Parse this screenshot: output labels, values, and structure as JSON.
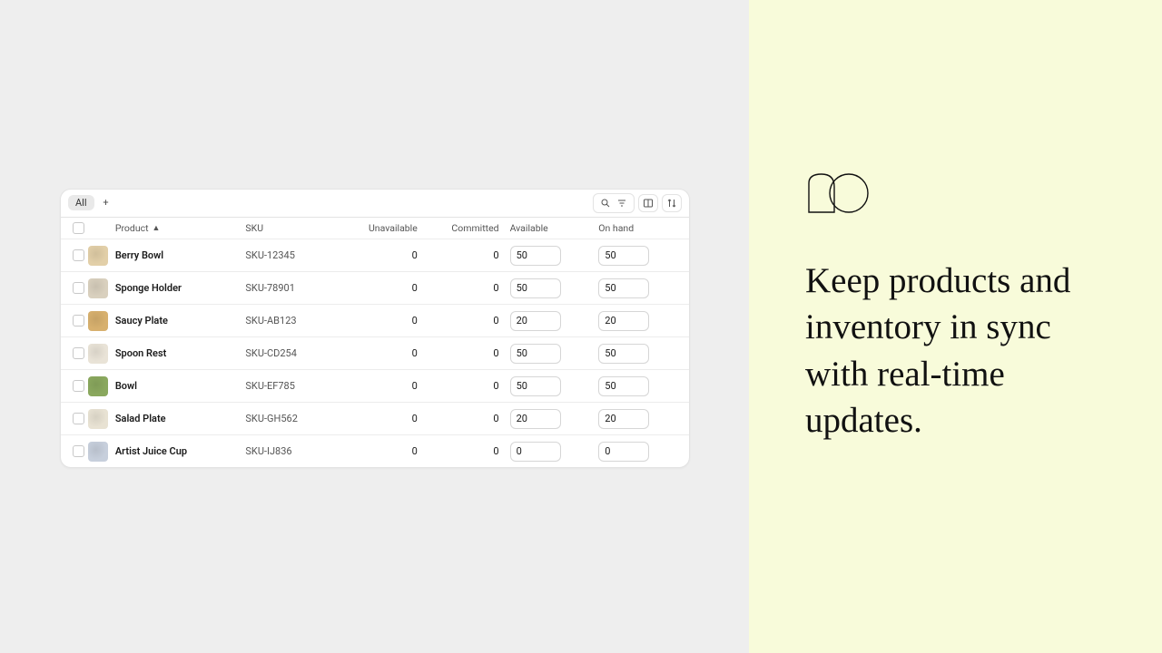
{
  "toolbar": {
    "tab_all": "All"
  },
  "columns": {
    "product": "Product",
    "sku": "SKU",
    "unavailable": "Unavailable",
    "committed": "Committed",
    "available": "Available",
    "on_hand": "On hand"
  },
  "rows": [
    {
      "name": "Berry Bowl",
      "sku": "SKU-12345",
      "unavailable": "0",
      "committed": "0",
      "available": "50",
      "on_hand": "50",
      "thumb": "#e2cfa8"
    },
    {
      "name": "Sponge Holder",
      "sku": "SKU-78901",
      "unavailable": "0",
      "committed": "0",
      "available": "50",
      "on_hand": "50",
      "thumb": "#d9d0be"
    },
    {
      "name": "Saucy Plate",
      "sku": "SKU-AB123",
      "unavailable": "0",
      "committed": "0",
      "available": "20",
      "on_hand": "20",
      "thumb": "#d7b06e"
    },
    {
      "name": "Spoon Rest",
      "sku": "SKU-CD254",
      "unavailable": "0",
      "committed": "0",
      "available": "50",
      "on_hand": "50",
      "thumb": "#e9e3d7"
    },
    {
      "name": "Bowl",
      "sku": "SKU-EF785",
      "unavailable": "0",
      "committed": "0",
      "available": "50",
      "on_hand": "50",
      "thumb": "#8aa85e"
    },
    {
      "name": "Salad Plate",
      "sku": "SKU-GH562",
      "unavailable": "0",
      "committed": "0",
      "available": "20",
      "on_hand": "20",
      "thumb": "#e8e2d3"
    },
    {
      "name": "Artist Juice Cup",
      "sku": "SKU-IJ836",
      "unavailable": "0",
      "committed": "0",
      "available": "0",
      "on_hand": "0",
      "thumb": "#c7cfdc"
    }
  ],
  "promo": {
    "headline": "Keep products and inventory in sync with real-time updates."
  }
}
